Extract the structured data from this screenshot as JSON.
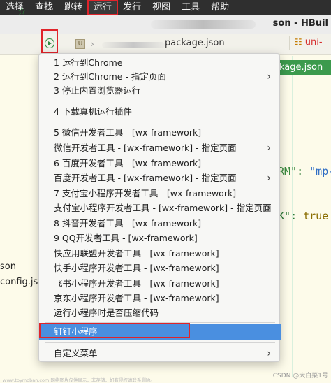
{
  "menubar": {
    "items": [
      "选择",
      "查找",
      "跳转",
      "运行",
      "发行",
      "视图",
      "工具",
      "帮助"
    ],
    "highlighted": "运行"
  },
  "title": {
    "app_title": "son - HBuil"
  },
  "toolbar": {
    "file_tab": "package.json",
    "uni_tab": "uni-",
    "tab_icon": "U"
  },
  "editor": {
    "pkg_tab": "kage.json",
    "code_line1_key": "RM\"",
    "code_line1_colon": ":",
    "code_line1_val": "\"mp-",
    "code_line2_key": "K\"",
    "code_line2_colon": ":",
    "code_line2_val": "true",
    "side_text1": "son",
    "side_text2": "config.json"
  },
  "menu": {
    "group1": [
      {
        "label": "1 运行到Chrome",
        "submenu": false
      },
      {
        "label": "2 运行到Chrome - 指定页面",
        "submenu": true
      },
      {
        "label": "3 停止内置浏览器运行",
        "submenu": false
      }
    ],
    "group2": [
      {
        "label": "4 下载真机运行插件",
        "submenu": false
      }
    ],
    "group3": [
      {
        "label": "5 微信开发者工具 - [wx-framework]",
        "submenu": false
      },
      {
        "label": "微信开发者工具 - [wx-framework] - 指定页面",
        "submenu": true
      },
      {
        "label": "6 百度开发者工具 - [wx-framework]",
        "submenu": false
      },
      {
        "label": "百度开发者工具 - [wx-framework] - 指定页面",
        "submenu": true
      },
      {
        "label": "7 支付宝小程序开发者工具 - [wx-framework]",
        "submenu": false
      },
      {
        "label": "支付宝小程序开发者工具 - [wx-framework] - 指定页面",
        "submenu": true
      },
      {
        "label": "8 抖音开发者工具 - [wx-framework]",
        "submenu": false
      },
      {
        "label": "9 QQ开发者工具 - [wx-framework]",
        "submenu": false
      },
      {
        "label": "快应用联盟开发者工具 - [wx-framework]",
        "submenu": false
      },
      {
        "label": "快手小程序开发者工具 - [wx-framework]",
        "submenu": false
      },
      {
        "label": "飞书小程序开发者工具 - [wx-framework]",
        "submenu": false
      },
      {
        "label": "京东小程序开发者工具 - [wx-framework]",
        "submenu": false
      },
      {
        "label": "运行小程序时是否压缩代码",
        "submenu": false
      }
    ],
    "group4": [
      {
        "label": "钉钉小程序",
        "submenu": false,
        "active": true
      }
    ],
    "group5": [
      {
        "label": "自定义菜单",
        "submenu": true
      }
    ],
    "arrow_glyph": "›"
  },
  "watermark": {
    "left": "www.toymoban.com 网络图片仅供展示，非存储，如有侵权请联系删除。",
    "right": "CSDN @大白菜1号"
  },
  "colors": {
    "accent_red": "#e0242b",
    "highlight_blue": "#4a8fe0",
    "green": "#2e8b3e"
  }
}
